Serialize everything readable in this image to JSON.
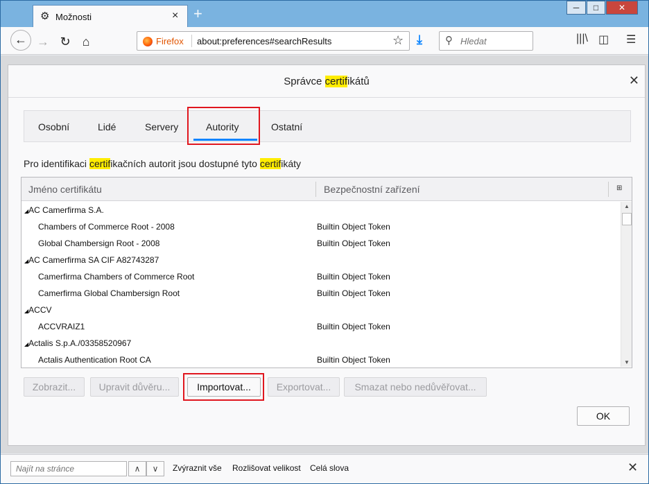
{
  "window": {
    "tab_title": "Možnosti",
    "min_glyph": "─",
    "max_glyph": "□",
    "close_glyph": "✕"
  },
  "navbar": {
    "identity_label": "Firefox",
    "url": "about:preferences#searchResults",
    "search_placeholder": "Hledat"
  },
  "dialog": {
    "title_pre": "Správce ",
    "title_hl": "certif",
    "title_post": "ikátů",
    "tabs": [
      "Osobní",
      "Lidé",
      "Servery",
      "Autority",
      "Ostatní"
    ],
    "active_tab": "Autority",
    "desc_parts": [
      "Pro identifikaci ",
      "certif",
      "ikačních autorit jsou dostupné tyto ",
      "certif",
      "ikáty"
    ],
    "columns": [
      "Jméno certifikátu",
      "Bezpečnostní zařízení"
    ],
    "rows": [
      {
        "type": "group",
        "name": "AC Camerfirma S.A.",
        "token": ""
      },
      {
        "type": "item",
        "name": "Chambers of Commerce Root - 2008",
        "token": "Builtin Object Token"
      },
      {
        "type": "item",
        "name": "Global Chambersign Root - 2008",
        "token": "Builtin Object Token"
      },
      {
        "type": "group",
        "name": "AC Camerfirma SA CIF A82743287",
        "token": ""
      },
      {
        "type": "item",
        "name": "Camerfirma Chambers of Commerce Root",
        "token": "Builtin Object Token"
      },
      {
        "type": "item",
        "name": "Camerfirma Global Chambersign Root",
        "token": "Builtin Object Token"
      },
      {
        "type": "group",
        "name": "ACCV",
        "token": ""
      },
      {
        "type": "item",
        "name": "ACCVRAIZ1",
        "token": "Builtin Object Token"
      },
      {
        "type": "group",
        "name": "Actalis S.p.A./03358520967",
        "token": ""
      },
      {
        "type": "item",
        "name": "Actalis Authentication Root CA",
        "token": "Builtin Object Token"
      }
    ],
    "buttons": {
      "view": "Zobrazit...",
      "edit": "Upravit důvěru...",
      "import": "Importovat...",
      "export": "Exportovat...",
      "delete": "Smazat nebo nedůvěřovat...",
      "ok": "OK"
    }
  },
  "findbar": {
    "placeholder": "Najít na stránce",
    "highlight": "Zvýraznit vše",
    "match_case": "Rozlišovat velikost",
    "whole_words": "Celá slova"
  },
  "colors": {
    "highlight": "#ffed00",
    "accent": "#0a84ff",
    "annotation": "#e0161e"
  }
}
